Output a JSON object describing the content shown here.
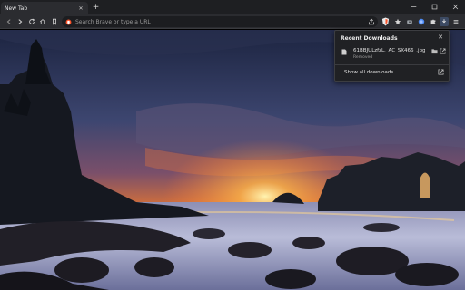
{
  "tabs": [
    {
      "label": "New Tab",
      "close_glyph": "✕"
    }
  ],
  "new_tab_glyph": "+",
  "omnibox": {
    "placeholder": "Search Brave or type a URL",
    "value": ""
  },
  "icons": {
    "back": "back-arrow-icon",
    "forward": "forward-arrow-icon",
    "reload": "reload-icon",
    "home": "home-icon",
    "bookmark": "bookmark-icon",
    "share": "share-icon",
    "brave_shield": "brave-shield-icon",
    "star": "star-icon",
    "vpn": "vpn-icon",
    "wallet": "wallet-icon",
    "extensions": "puzzle-icon",
    "downloads": "download-icon",
    "menu": "hamburger-menu-icon"
  },
  "downloads_popup": {
    "title": "Recent Downloads",
    "close_glyph": "✕",
    "items": [
      {
        "filename": "61BBJULzfzL._AC_SX466_.jpg",
        "status": "Removed"
      }
    ],
    "show_all_label": "Show all downloads"
  },
  "colors": {
    "tabstrip_bg": "#1e1f22",
    "toolbar_bg": "#2b2c30",
    "omnibox_bg": "#1c1d20",
    "popup_bg": "#202124",
    "accent_blue": "#4c8bf5",
    "brave_orange": "#fb542b"
  }
}
